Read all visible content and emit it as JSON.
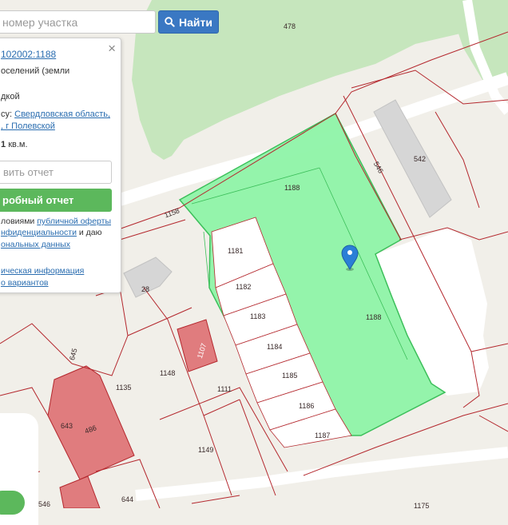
{
  "search": {
    "placeholder": "номер участка",
    "button_label": "Найти",
    "button_icon": "search-icon"
  },
  "popup": {
    "cadastral_link": "102002:1188",
    "category_text": "оселений (земли",
    "use_text": "дкой",
    "address_prefix": "су:",
    "address_link_1": "Свердловская область,",
    "address_link_2": ", г Полевской",
    "area_value": "1",
    "area_unit": "кв.м.",
    "report_placeholder": "вить отчет",
    "detailed_report_button": "робный отчет",
    "terms_prefix": "ловиями",
    "terms_link_offer": "публичной оферты",
    "terms_link_privacy": "нфиденциальности",
    "terms_and_consent": "и даю",
    "terms_link_personal": "ональных данных",
    "info_link": "ическая информация",
    "variants_link": "о вариантов"
  },
  "map": {
    "selected_parcel_color": "#8ef3a8",
    "building_color": "#e07c7e",
    "boundary_color": "#b4282e",
    "marker_color": "#2b7fd6",
    "labels": {
      "l478": "478",
      "l542": "542",
      "l546": "546",
      "l1188a": "1188",
      "l1188b": "1188",
      "l1158": "1158",
      "l1181": "1181",
      "l1182": "1182",
      "l1183": "1183",
      "l1184": "1184",
      "l1185": "1185",
      "l1186": "1186",
      "l1187": "1187",
      "l28": "28",
      "l1107": "1107",
      "l1148": "1148",
      "l1111": "1111",
      "l1149": "1149",
      "l1135": "1135",
      "l645": "645",
      "l643": "643",
      "l486": "486",
      "l644": "644",
      "l546b": "546",
      "l1175": "1175"
    }
  }
}
